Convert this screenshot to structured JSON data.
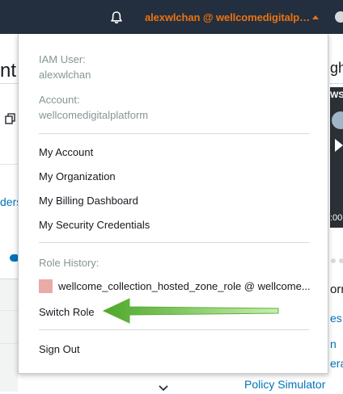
{
  "topbar": {
    "account_label": "alexwlchan @ wellcomedigitalp…",
    "bell_icon": "bell-icon",
    "caret_icon": "caret-up-icon"
  },
  "menu": {
    "iam_user_label": "IAM User:",
    "iam_user_value": "alexwlchan",
    "account_label": "Account:",
    "account_value": "wellcomedigitalplatform",
    "items": [
      {
        "label": "My Account"
      },
      {
        "label": "My Organization"
      },
      {
        "label": "My Billing Dashboard"
      },
      {
        "label": "My Security Credentials"
      }
    ],
    "role_history_label": "Role History:",
    "role_history_item": "wellcome_collection_hosted_zone_role @ wellcome...",
    "role_color": "#e9aaa8",
    "switch_role": "Switch Role",
    "sign_out": "Sign Out"
  },
  "background": {
    "left_title_fragment": "nt",
    "left_link_fragment": "ders",
    "right_title_fragment": "gh",
    "right_video_fragment_1": "WS",
    "right_video_time_fragment": ":00",
    "right_heading_fragment": "orn",
    "right_link_fragment_1": "es",
    "right_link_fragment_2": "n",
    "right_link_fragment_3": "era",
    "policy_simulator": "Policy Simulator"
  },
  "colors": {
    "topbar_bg": "#232f3e",
    "account_accent": "#ec7211",
    "link": "#0073bb",
    "arrow": "#6cc04a"
  }
}
